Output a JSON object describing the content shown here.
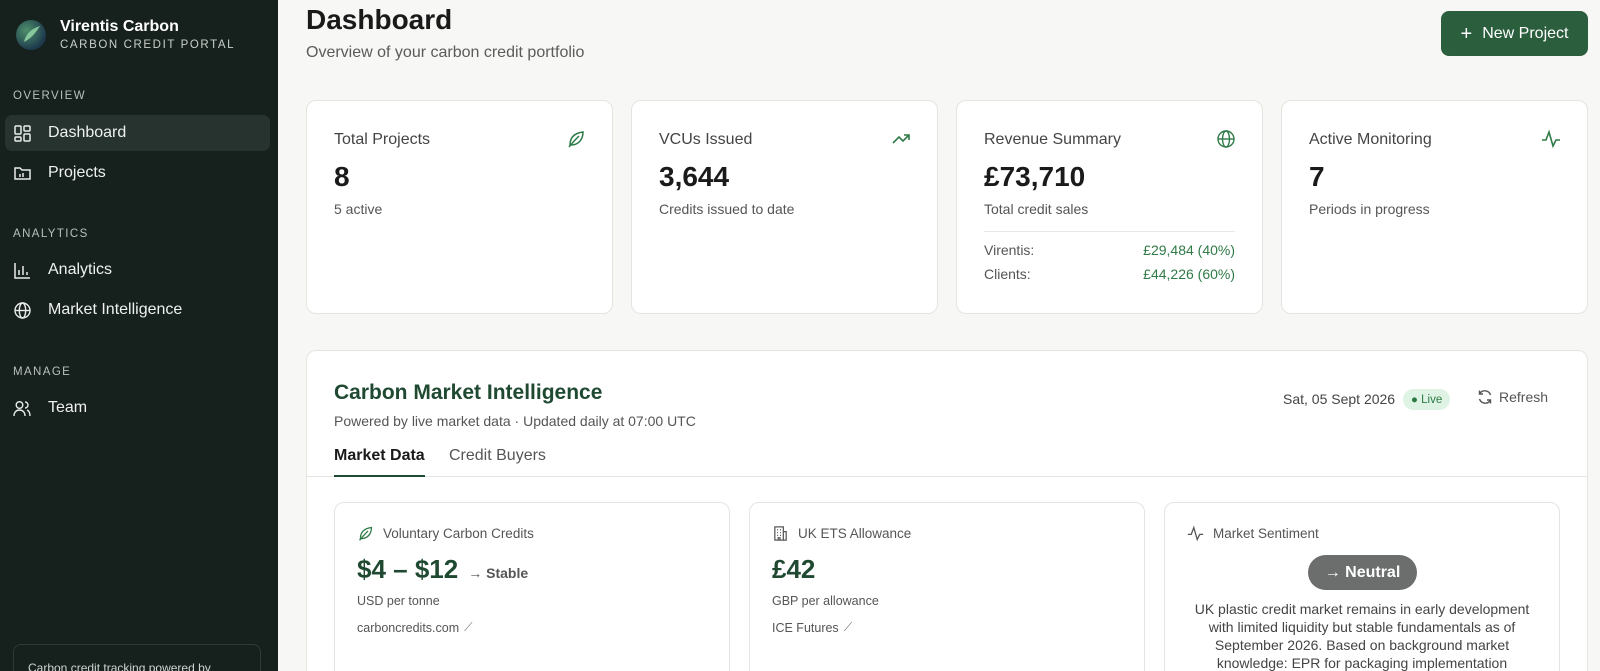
{
  "brand": {
    "name": "Virentis Carbon",
    "subtitle": "CARBON CREDIT PORTAL"
  },
  "sidebar": {
    "sections": [
      {
        "label": "OVERVIEW",
        "items": [
          {
            "label": "Dashboard",
            "icon": "dashboard-icon",
            "active": true
          },
          {
            "label": "Projects",
            "icon": "folder-icon"
          }
        ]
      },
      {
        "label": "ANALYTICS",
        "items": [
          {
            "label": "Analytics",
            "icon": "bar-chart-icon"
          },
          {
            "label": "Market Intelligence",
            "icon": "globe-icon"
          }
        ]
      },
      {
        "label": "MANAGE",
        "items": [
          {
            "label": "Team",
            "icon": "users-icon"
          }
        ]
      }
    ],
    "footer_text": "Carbon credit tracking powered by"
  },
  "header": {
    "title": "Dashboard",
    "subtitle": "Overview of your carbon credit portfolio",
    "new_project_label": "New Project"
  },
  "stats": [
    {
      "label": "Total Projects",
      "value": "8",
      "note": "5 active",
      "icon": "leaf-icon"
    },
    {
      "label": "VCUs Issued",
      "value": "3,644",
      "note": "Credits issued to date",
      "icon": "trending-up-icon"
    },
    {
      "label": "Revenue Summary",
      "value": "£73,710",
      "note": "Total credit sales",
      "icon": "globe-icon",
      "breakdown": [
        {
          "label": "Virentis:",
          "value": "£29,484 (40%)"
        },
        {
          "label": "Clients:",
          "value": "£44,226 (60%)"
        }
      ]
    },
    {
      "label": "Active Monitoring",
      "value": "7",
      "note": "Periods in progress",
      "icon": "activity-icon"
    }
  ],
  "market": {
    "title": "Carbon Market Intelligence",
    "subtitle": "Powered by live market data · Updated daily at 07:00 UTC",
    "date": "Sat, 05 Sept 2026",
    "live_label": "● Live",
    "refresh_label": "Refresh",
    "tabs": [
      {
        "label": "Market Data",
        "active": true
      },
      {
        "label": "Credit Buyers",
        "active": false
      }
    ],
    "cards": [
      {
        "title": "Voluntary Carbon Credits",
        "icon": "leaf-icon",
        "value": "$4 – $12",
        "trend": "→ Stable",
        "unit": "USD per tonne",
        "source": "carboncredits.com"
      },
      {
        "title": "UK ETS Allowance",
        "icon": "building-icon",
        "value": "£42",
        "unit": "GBP per allowance",
        "source": "ICE Futures"
      },
      {
        "title": "Market Sentiment",
        "icon": "activity-icon",
        "sentiment": "→ Neutral",
        "text": "UK plastic credit market remains in early development with limited liquidity but stable fundamentals as of September 2026. Based on background market knowledge: EPR for packaging implementation continues to drive compliance"
      }
    ]
  },
  "colors": {
    "sidebar_bg": "#16201d",
    "accent": "#2a5e3c",
    "positive": "#2f7a47",
    "live_bg": "#dff3e4"
  }
}
